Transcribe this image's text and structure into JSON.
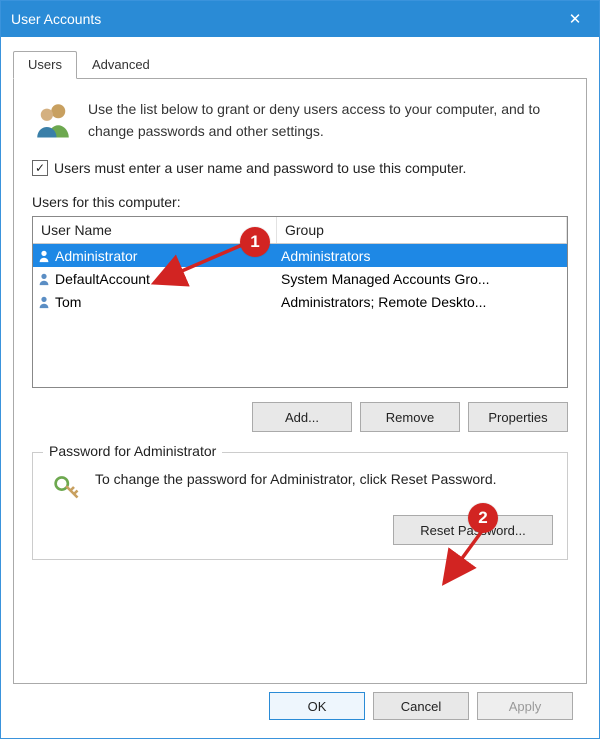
{
  "window": {
    "title": "User Accounts",
    "close_glyph": "✕"
  },
  "tabs": [
    {
      "label": "Users",
      "active": true
    },
    {
      "label": "Advanced",
      "active": false
    }
  ],
  "intro_text": "Use the list below to grant or deny users access to your computer, and to change passwords and other settings.",
  "checkbox": {
    "checked": true,
    "mark": "✓",
    "label": "Users must enter a user name and password to use this computer."
  },
  "users_section": {
    "label": "Users for this computer:",
    "columns": {
      "user": "User Name",
      "group": "Group"
    },
    "rows": [
      {
        "name": "Administrator",
        "group": "Administrators",
        "selected": true
      },
      {
        "name": "DefaultAccount",
        "group": "System Managed Accounts Gro...",
        "selected": false
      },
      {
        "name": "Tom",
        "group": "Administrators; Remote Deskto...",
        "selected": false
      }
    ],
    "buttons": {
      "add": "Add...",
      "remove": "Remove",
      "props": "Properties"
    }
  },
  "password_box": {
    "legend": "Password for Administrator",
    "text": "To change the password for Administrator, click Reset Password.",
    "reset_btn": "Reset Password..."
  },
  "footer": {
    "ok": "OK",
    "cancel": "Cancel",
    "apply": "Apply"
  },
  "annotations": {
    "badge1": "1",
    "badge2": "2",
    "color": "#d22422"
  }
}
